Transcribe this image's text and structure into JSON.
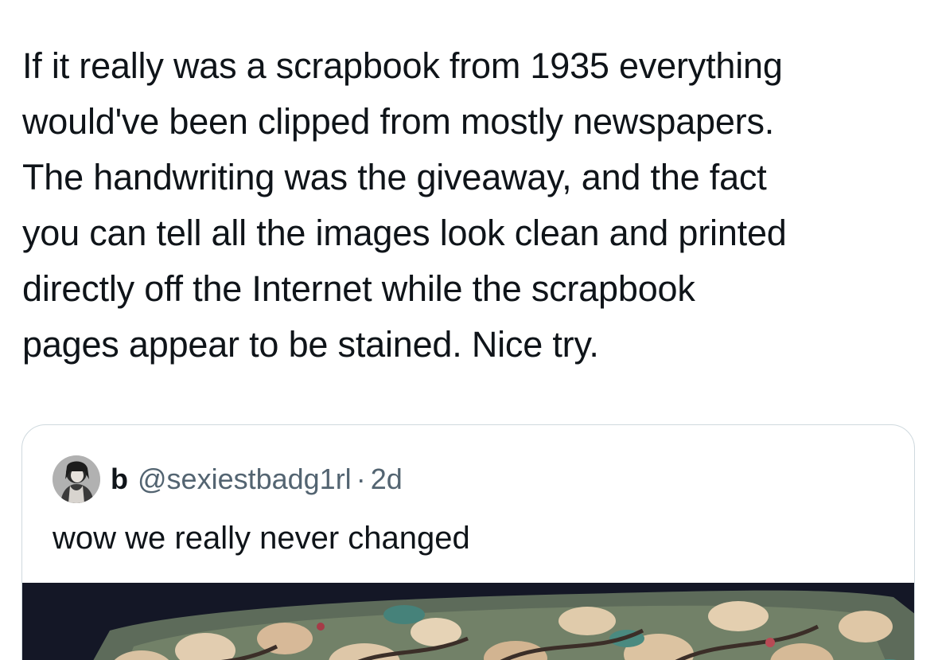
{
  "tweet": {
    "text": "If it really was a scrapbook from 1935 everything\nwould've been clipped from mostly newspapers.\nThe handwriting was the giveaway, and the fact\nyou can tell all the images look clean and printed\ndirectly off the Internet while the scrapbook\npages appear to be stained. Nice try."
  },
  "quoted_tweet": {
    "display_name": "b",
    "handle": "@sexiestbadg1rl",
    "separator": "·",
    "time": "2d",
    "text": "wow we really never changed",
    "avatar_icon": "user-avatar-icon",
    "media_icon": "scrapbook-photo-image"
  }
}
